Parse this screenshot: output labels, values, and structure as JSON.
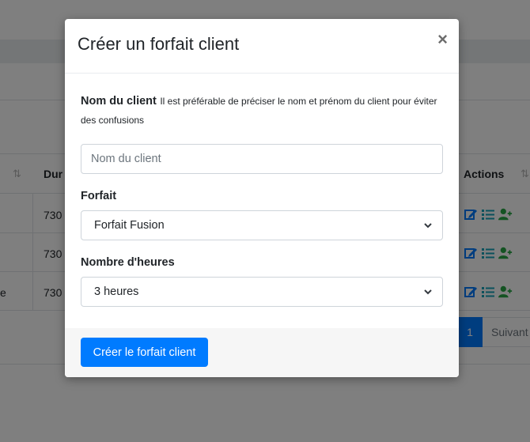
{
  "background": {
    "table": {
      "header_duration": "Dur",
      "header_actions": "Actions",
      "rows": [
        {
          "lead": "",
          "duration": "730"
        },
        {
          "lead": "",
          "duration": "730"
        },
        {
          "lead": "e",
          "duration": "730"
        }
      ]
    },
    "pagination": {
      "active_page": "1",
      "next_label": "Suivant"
    },
    "colors": {
      "edit": "#007bff",
      "list": "#17a2b8",
      "add_user": "#28a745"
    }
  },
  "modal": {
    "title": "Créer un forfait client",
    "close_label": "×",
    "client_name": {
      "label": "Nom du client",
      "hint": "Il est préférable de préciser le nom et prénom du client pour éviter des confusions",
      "placeholder": "Nom du client",
      "value": ""
    },
    "package": {
      "label": "Forfait",
      "selected": "Forfait Fusion"
    },
    "hours": {
      "label": "Nombre d'heures",
      "selected": "3 heures"
    },
    "submit_label": "Créer le forfait client"
  }
}
